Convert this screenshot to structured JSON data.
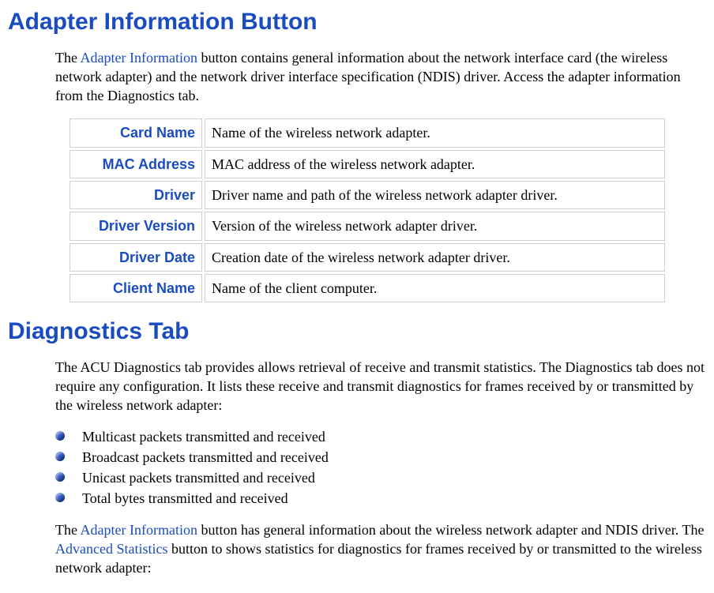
{
  "section1": {
    "heading": "Adapter Information Button",
    "intro_pre": "The ",
    "intro_link": "Adapter Information",
    "intro_post": " button contains general information about the network interface card (the wireless network adapter) and the network driver interface specification (NDIS) driver.  Access the adapter information from the Diagnostics tab.",
    "table": [
      {
        "label": "Card Name",
        "desc": "Name of the wireless network adapter."
      },
      {
        "label": "MAC Address",
        "desc": "MAC address of the wireless network adapter."
      },
      {
        "label": "Driver",
        "desc": "Driver name and path of the wireless network adapter driver."
      },
      {
        "label": "Driver Version",
        "desc": "Version of the wireless network adapter driver."
      },
      {
        "label": "Driver Date",
        "desc": "Creation date of the wireless network adapter driver."
      },
      {
        "label": "Client Name",
        "desc": "Name of the client computer."
      }
    ]
  },
  "section2": {
    "heading": "Diagnostics Tab",
    "intro": "The ACU Diagnostics tab provides allows retrieval of receive and transmit statistics. The Diagnostics tab does not require any configuration.  It lists these receive and transmit diagnostics for frames received by or transmitted by the wireless network adapter:",
    "bullets": [
      "Multicast packets transmitted and received",
      "Broadcast packets transmitted and received",
      "Unicast packets transmitted and received",
      "Total bytes transmitted and received"
    ],
    "outro_p1": "The ",
    "outro_link1": "Adapter Information",
    "outro_p2": " button has general information about the wireless network adapter and NDIS driver.  The ",
    "outro_link2": "Advanced Statistics",
    "outro_p3": " button to shows statistics for diagnostics for frames received by or transmitted to the wireless network adapter:"
  }
}
